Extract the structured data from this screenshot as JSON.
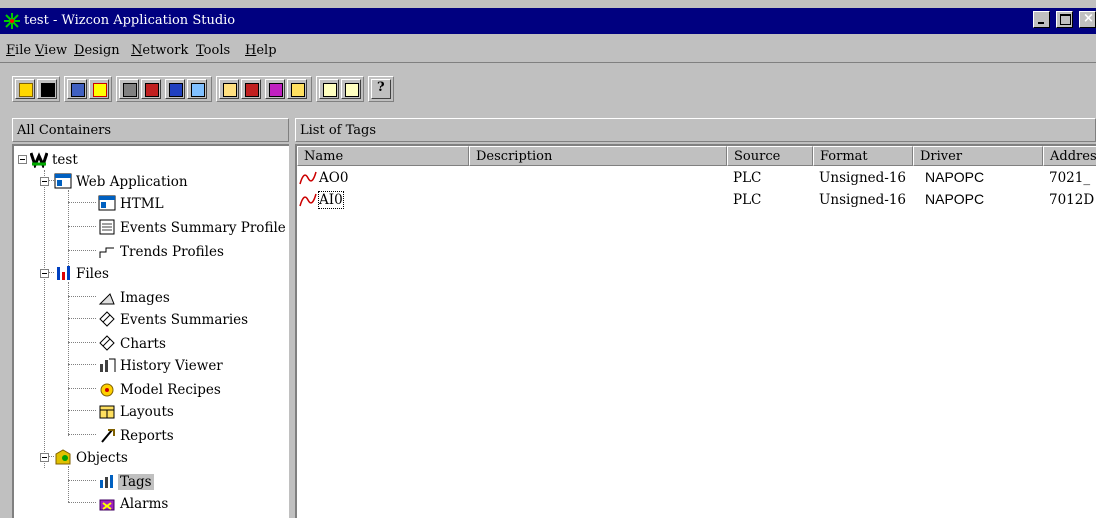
{
  "window": {
    "title": "test - Wizcon Application Studio"
  },
  "menu": [
    {
      "label": "File",
      "u": "F",
      "rest": "ile"
    },
    {
      "label": "View",
      "u": "V",
      "rest": "iew"
    },
    {
      "label": "Design",
      "u": "D",
      "rest": "esign"
    },
    {
      "label": "Network",
      "u": "N",
      "rest": "etwork"
    },
    {
      "label": "Tools",
      "u": "T",
      "rest": "ools"
    },
    {
      "label": "Help",
      "u": "H",
      "rest": "elp"
    }
  ],
  "left_pane": {
    "header": "All Containers"
  },
  "tree": {
    "root": "test",
    "web_application": "Web Application",
    "html": "HTML",
    "events_summary_profile": "Events Summary Profile",
    "trends_profiles": "Trends Profiles",
    "files": "Files",
    "images": "Images",
    "events_summaries": "Events Summaries",
    "charts": "Charts",
    "history_viewer": "History Viewer",
    "model_recipes": "Model Recipes",
    "layouts": "Layouts",
    "reports": "Reports",
    "objects": "Objects",
    "tags": "Tags",
    "alarms": "Alarms"
  },
  "right_pane": {
    "header": "List of Tags",
    "columns": [
      "Name",
      "Description",
      "Source",
      "Format",
      "Driver",
      "Address"
    ],
    "rows": [
      {
        "name": "AO0",
        "description": "",
        "source": "PLC",
        "format": "Unsigned-16",
        "driver": "NAPOPC",
        "address": "7021_"
      },
      {
        "name": "AI0",
        "description": "",
        "source": "PLC",
        "format": "Unsigned-16",
        "driver": "NAPOPC",
        "address": "7012D"
      }
    ]
  },
  "colors": {
    "titlebar": "#000080",
    "face": "#c0c0c0",
    "tag_icon": "#cc0000"
  }
}
